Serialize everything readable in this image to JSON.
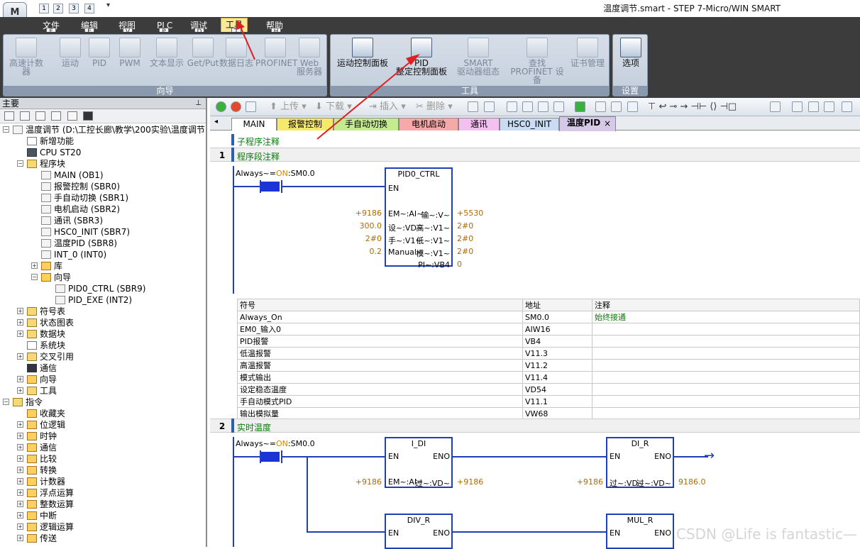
{
  "window": {
    "title": "温度调节.smart - STEP 7-Micro/WIN SMART",
    "app_button": "M",
    "quick_access": [
      "1",
      "2",
      "3",
      "4"
    ]
  },
  "menu": {
    "items": [
      {
        "label": "文件",
        "key": "F"
      },
      {
        "label": "编辑",
        "key": "E"
      },
      {
        "label": "视图",
        "key": "V"
      },
      {
        "label": "PLC",
        "key": "P"
      },
      {
        "label": "调试",
        "key": "D"
      },
      {
        "label": "工具",
        "key": "T"
      },
      {
        "label": "帮助",
        "key": "H"
      }
    ],
    "active": "工具"
  },
  "ribbon": {
    "groups": [
      {
        "label": "向导",
        "buttons": [
          "高速计数器",
          "运动",
          "PID",
          "PWM",
          "文本显示",
          "Get/Put",
          "数据日志",
          "PROFINET",
          "Web\n服务器"
        ]
      },
      {
        "label": "工具",
        "buttons": [
          "运动控制面板",
          "PID\n整定控制面板",
          "SMART\n驱动器组态",
          "查找\nPROFINET 设备",
          "证书管理"
        ]
      },
      {
        "label": "设置",
        "buttons": [
          "选项"
        ]
      }
    ]
  },
  "left_pane": {
    "title": "主要",
    "tree": [
      {
        "text": "温度调节 (D:\\工控长廊\\教学\\200实验\\温度调节)",
        "icon": "project-icon"
      },
      {
        "text": "新增功能",
        "icon": "help-icon"
      },
      {
        "text": "CPU ST20",
        "icon": "cpu-icon"
      },
      {
        "text": "程序块",
        "icon": "folder-icon"
      },
      {
        "text": "MAIN (OB1)",
        "icon": "block-icon"
      },
      {
        "text": "报警控制 (SBR0)",
        "icon": "block-icon"
      },
      {
        "text": "手自动切换 (SBR1)",
        "icon": "block-icon"
      },
      {
        "text": "电机启动 (SBR2)",
        "icon": "block-icon"
      },
      {
        "text": "通讯 (SBR3)",
        "icon": "block-icon"
      },
      {
        "text": "HSC0_INIT (SBR7)",
        "icon": "block-icon"
      },
      {
        "text": "温度PID (SBR8)",
        "icon": "block-icon"
      },
      {
        "text": "INT_0 (INT0)",
        "icon": "block-icon"
      },
      {
        "text": "库",
        "icon": "library-icon"
      },
      {
        "text": "向导",
        "icon": "wizard-icon"
      },
      {
        "text": "PID0_CTRL (SBR9)",
        "icon": "block-icon"
      },
      {
        "text": "PID_EXE (INT2)",
        "icon": "block-icon"
      },
      {
        "text": "符号表",
        "icon": "folder-icon"
      },
      {
        "text": "状态图表",
        "icon": "folder-icon"
      },
      {
        "text": "数据块",
        "icon": "folder-icon"
      },
      {
        "text": "系统块",
        "icon": "document-icon"
      },
      {
        "text": "交叉引用",
        "icon": "folder-icon"
      },
      {
        "text": "通信",
        "icon": "pc-icon"
      },
      {
        "text": "向导",
        "icon": "folder-icon"
      },
      {
        "text": "工具",
        "icon": "folder-icon"
      },
      {
        "text": "指令",
        "icon": "folder-icon"
      },
      {
        "text": "收藏夹",
        "icon": "instruction-icon"
      },
      {
        "text": "位逻辑",
        "icon": "instruction-icon"
      },
      {
        "text": "时钟",
        "icon": "instruction-icon"
      },
      {
        "text": "通信",
        "icon": "instruction-icon"
      },
      {
        "text": "比较",
        "icon": "instruction-icon"
      },
      {
        "text": "转换",
        "icon": "instruction-icon"
      },
      {
        "text": "计数器",
        "icon": "instruction-icon"
      },
      {
        "text": "浮点运算",
        "icon": "instruction-icon"
      },
      {
        "text": "整数运算",
        "icon": "instruction-icon"
      },
      {
        "text": "中断",
        "icon": "instruction-icon"
      },
      {
        "text": "逻辑运算",
        "icon": "instruction-icon"
      },
      {
        "text": "传送",
        "icon": "instruction-icon"
      }
    ]
  },
  "toolbar": {
    "upload": "上传",
    "download": "下载",
    "insert": "插入",
    "delete": "删除"
  },
  "tabs": [
    "MAIN",
    "报警控制",
    "手自动切换",
    "电机启动",
    "通讯",
    "HSC0_INIT",
    "温度PID"
  ],
  "tab_colors": [
    "#ffffff",
    "#f6e96a",
    "#c4ec8f",
    "#f7a9a9",
    "#f3c0f0",
    "#c9dcf3",
    "#d6c9e8"
  ],
  "editor": {
    "sub_comment": "子程序注释",
    "network1": {
      "num": "1",
      "comment": "程序段注释",
      "contact_label": "Always~=",
      "contact_on": "ON",
      "contact_addr": ":SM0.0",
      "block": "PID0_CTRL",
      "en": "EN",
      "inputs": [
        {
          "pin": "EM~:AI~",
          "val": "+9186"
        },
        {
          "pin": "设~:VD~",
          "val": "300.0"
        },
        {
          "pin": "手~:V1~",
          "val": "2#0"
        },
        {
          "pin": "Manual~",
          "val": "0.2"
        }
      ],
      "outputs": [
        {
          "pin": "输~:V~",
          "val": "+5530"
        },
        {
          "pin": "高~:V1~",
          "val": "2#0"
        },
        {
          "pin": "低~:V1~",
          "val": "2#0"
        },
        {
          "pin": "模~:V1~",
          "val": "2#0"
        },
        {
          "pin": "PI~:VB4",
          "val": "0"
        }
      ]
    },
    "symbols": {
      "headers": [
        "符号",
        "地址",
        "注释"
      ],
      "rows": [
        [
          "Always_On",
          "SM0.0",
          "始终接通"
        ],
        [
          "EM0_输入0",
          "AIW16",
          ""
        ],
        [
          "PID报警",
          "VB4",
          ""
        ],
        [
          "低温报警",
          "V11.3",
          ""
        ],
        [
          "高温报警",
          "V11.2",
          ""
        ],
        [
          "模式输出",
          "V11.4",
          ""
        ],
        [
          "设定稳态温度",
          "VD54",
          ""
        ],
        [
          "手自动模式PID",
          "V11.1",
          ""
        ],
        [
          "输出模拟量",
          "VW68",
          ""
        ]
      ]
    },
    "network2": {
      "num": "2",
      "comment": "实时温度",
      "contact_label": "Always~=",
      "contact_on": "ON",
      "contact_addr": ":SM0.0",
      "blocks": [
        {
          "name": "I_DI",
          "en": "EN",
          "eno": "ENO",
          "in_pin": "EM~:AI~",
          "in_val": "+9186",
          "out_pin": "过~:VD~",
          "out_val": "+9186"
        },
        {
          "name": "DI_R",
          "en": "EN",
          "eno": "ENO",
          "in_pin": "过~:VD~",
          "in_val": "+9186",
          "out_pin": "过~:VD~",
          "out_val": "9186.0"
        },
        {
          "name": "DIV_R",
          "en": "EN",
          "eno": "ENO"
        },
        {
          "name": "MUL_R",
          "en": "EN",
          "eno": "ENO"
        }
      ]
    }
  },
  "watermark": "CSDN @Life is fantastic—"
}
